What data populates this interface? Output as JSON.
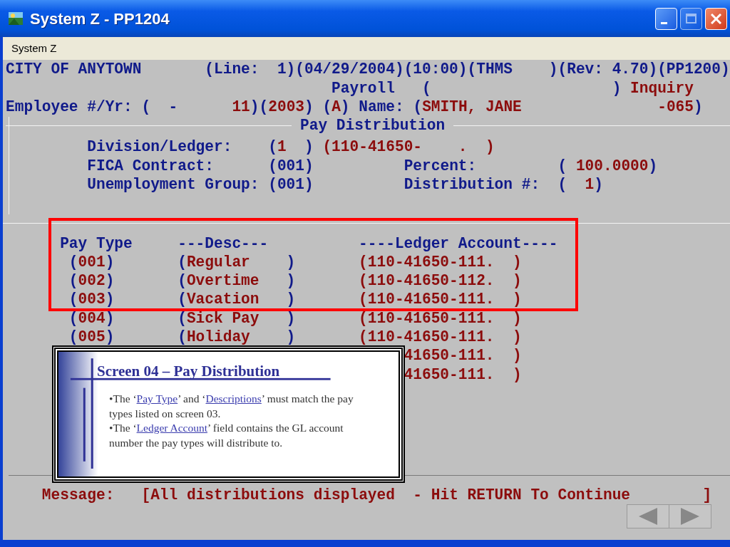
{
  "window": {
    "title": "System Z - PP1204"
  },
  "menu": [
    {
      "label": "System Z"
    }
  ],
  "terminal": {
    "header_lines": [
      [
        {
          "parts": [
            {
              "text": "CITY OF ANYTOWN",
              "color": "#101a8a"
            }
          ]
        },
        {
          "parts": [
            {
              "text": "       (Line:  1)",
              "color": "#101a8a"
            }
          ]
        },
        {
          "parts": [
            {
              "text": "(04/29/2004)",
              "color": "#101a8a"
            }
          ]
        },
        {
          "parts": [
            {
              "text": "(10:00)",
              "color": "#101a8a"
            }
          ]
        },
        {
          "parts": [
            {
              "text": "(THMS    )",
              "color": "#101a8a"
            }
          ]
        },
        {
          "parts": [
            {
              "text": "(Rev: 4.70)",
              "color": "#101a8a"
            }
          ]
        },
        {
          "parts": [
            {
              "text": "(PP1200)",
              "color": "#101a8a"
            }
          ]
        }
      ],
      [
        {
          "parts": [
            {
              "text": "                                    Payroll",
              "color": "#101a8a"
            }
          ]
        },
        {
          "parts": [
            {
              "text": "   (                    )",
              "color": "#101a8a"
            }
          ]
        },
        {
          "parts": [
            {
              "text": " Inquiry",
              "color": "#8c0c0c"
            }
          ]
        }
      ],
      [
        {
          "parts": [
            {
              "text": "Employee #/Yr:",
              "color": "#101a8a"
            }
          ]
        },
        {
          "parts": [
            {
              "text": " (  -      ",
              "color": "#101a8a"
            },
            {
              "text": "11",
              "color": "#8c0c0c"
            },
            {
              "text": ")",
              "color": "#101a8a"
            }
          ]
        },
        {
          "parts": [
            {
              "text": "(",
              "color": "#101a8a"
            },
            {
              "text": "2003",
              "color": "#8c0c0c"
            },
            {
              "text": ")",
              "color": "#101a8a"
            }
          ]
        },
        {
          "parts": [
            {
              "text": " (",
              "color": "#101a8a"
            },
            {
              "text": "A",
              "color": "#8c0c0c"
            },
            {
              "text": ")",
              "color": "#101a8a"
            }
          ]
        },
        {
          "parts": [
            {
              "text": " Name:",
              "color": "#101a8a"
            }
          ]
        },
        {
          "parts": [
            {
              "text": " (",
              "color": "#101a8a"
            },
            {
              "text": "SMITH, JANE               -065",
              "color": "#8c0c0c"
            },
            {
              "text": ")",
              "color": "#101a8a"
            }
          ]
        }
      ]
    ],
    "section_title": "Pay Distribution",
    "detail_lines": [
      [
        {
          "parts": [
            {
              "text": "         Division/Ledger:",
              "color": "#101a8a"
            }
          ]
        },
        {
          "parts": [
            {
              "text": "    (",
              "color": "#101a8a"
            },
            {
              "text": "1",
              "color": "#8c0c0c"
            },
            {
              "text": "  )",
              "color": "#101a8a"
            }
          ]
        },
        {
          "parts": [
            {
              "text": " (110-41650-    .  )",
              "color": "#8c0c0c"
            }
          ]
        }
      ],
      [
        {
          "parts": [
            {
              "text": "         FICA Contract:",
              "color": "#101a8a"
            }
          ]
        },
        {
          "parts": [
            {
              "text": "      (001)",
              "color": "#101a8a"
            }
          ]
        },
        {
          "parts": [
            {
              "text": "          Percent:",
              "color": "#101a8a"
            }
          ]
        },
        {
          "parts": [
            {
              "text": "         (",
              "color": "#101a8a"
            },
            {
              "text": " 100.0000",
              "color": "#8c0c0c"
            },
            {
              "text": ")",
              "color": "#101a8a"
            }
          ]
        }
      ],
      [
        {
          "parts": [
            {
              "text": "         Unemployment Group:",
              "color": "#101a8a"
            }
          ]
        },
        {
          "parts": [
            {
              "text": " (001)",
              "color": "#101a8a"
            }
          ]
        },
        {
          "parts": [
            {
              "text": "          Distribution #:",
              "color": "#101a8a"
            }
          ]
        },
        {
          "parts": [
            {
              "text": "  (",
              "color": "#101a8a"
            },
            {
              "text": "  1",
              "color": "#8c0c0c"
            },
            {
              "text": ")",
              "color": "#101a8a"
            }
          ]
        }
      ]
    ],
    "table": {
      "columns": [
        "Pay Type",
        "---Desc---",
        "----Ledger Account----"
      ],
      "rows": [
        {
          "pay_type": [
            {
              "text": "(",
              "color": "#101a8a"
            },
            {
              "text": "001",
              "color": "#8c0c0c"
            },
            {
              "text": ")",
              "color": "#101a8a"
            }
          ],
          "desc": [
            {
              "text": "(",
              "color": "#101a8a"
            },
            {
              "text": "Regular    ",
              "color": "#8c0c0c"
            },
            {
              "text": ")",
              "color": "#101a8a"
            }
          ],
          "ledger": [
            {
              "text": "(110-41650-111.  )",
              "color": "#8c0c0c"
            }
          ]
        },
        {
          "pay_type": [
            {
              "text": "(",
              "color": "#101a8a"
            },
            {
              "text": "002",
              "color": "#8c0c0c"
            },
            {
              "text": ")",
              "color": "#101a8a"
            }
          ],
          "desc": [
            {
              "text": "(",
              "color": "#101a8a"
            },
            {
              "text": "Overtime   ",
              "color": "#8c0c0c"
            },
            {
              "text": ")",
              "color": "#101a8a"
            }
          ],
          "ledger": [
            {
              "text": "(110-41650-112.  )",
              "color": "#8c0c0c"
            }
          ]
        },
        {
          "pay_type": [
            {
              "text": "(",
              "color": "#101a8a"
            },
            {
              "text": "003",
              "color": "#8c0c0c"
            },
            {
              "text": ")",
              "color": "#101a8a"
            }
          ],
          "desc": [
            {
              "text": "(",
              "color": "#101a8a"
            },
            {
              "text": "Vacation   ",
              "color": "#8c0c0c"
            },
            {
              "text": ")",
              "color": "#101a8a"
            }
          ],
          "ledger": [
            {
              "text": "(110-41650-111.  )",
              "color": "#8c0c0c"
            }
          ]
        },
        {
          "pay_type": [
            {
              "text": "(",
              "color": "#101a8a"
            },
            {
              "text": "004",
              "color": "#8c0c0c"
            },
            {
              "text": ")",
              "color": "#101a8a"
            }
          ],
          "desc": [
            {
              "text": "(",
              "color": "#101a8a"
            },
            {
              "text": "Sick Pay   ",
              "color": "#8c0c0c"
            },
            {
              "text": ")",
              "color": "#101a8a"
            }
          ],
          "ledger": [
            {
              "text": "(110-41650-111.  )",
              "color": "#8c0c0c"
            }
          ]
        },
        {
          "pay_type": [
            {
              "text": "(",
              "color": "#101a8a"
            },
            {
              "text": "005",
              "color": "#8c0c0c"
            },
            {
              "text": ")",
              "color": "#101a8a"
            }
          ],
          "desc": [
            {
              "text": "(",
              "color": "#101a8a"
            },
            {
              "text": "Holiday    ",
              "color": "#8c0c0c"
            },
            {
              "text": ")",
              "color": "#101a8a"
            }
          ],
          "ledger": [
            {
              "text": "(110-41650-111.  )",
              "color": "#8c0c0c"
            }
          ]
        },
        {
          "ledger": [
            {
              "text": "41650-111.  )",
              "color": "#8c0c0c"
            }
          ]
        },
        {
          "ledger": [
            {
              "text": "41650-111.  )",
              "color": "#8c0c0c"
            }
          ]
        }
      ]
    },
    "message_line": [
      {
        "parts": [
          {
            "text": "    Message:",
            "color": "#8c0c0c"
          }
        ]
      },
      {
        "parts": [
          {
            "text": "   [All distributions displayed  - Hit RETURN To Continue        ]",
            "color": "#8c0c0c"
          }
        ]
      }
    ]
  },
  "callout": {
    "title": "Screen 04 – Pay Distribution",
    "paragraphs": [
      [
        {
          "text": "•The ‘",
          "link": false
        },
        {
          "text": "Pay Type",
          "link": true
        },
        {
          "text": "’ and ‘",
          "link": false
        },
        {
          "text": "Descriptions",
          "link": true
        },
        {
          "text": "’ must match the pay types listed on screen 03.",
          "link": false
        }
      ],
      [
        {
          "text": "•The ‘",
          "link": false
        },
        {
          "text": "Ledger Account",
          "link": true
        },
        {
          "text": "’ field contains the GL account number the pay types will distribute to.",
          "link": false
        }
      ]
    ]
  }
}
